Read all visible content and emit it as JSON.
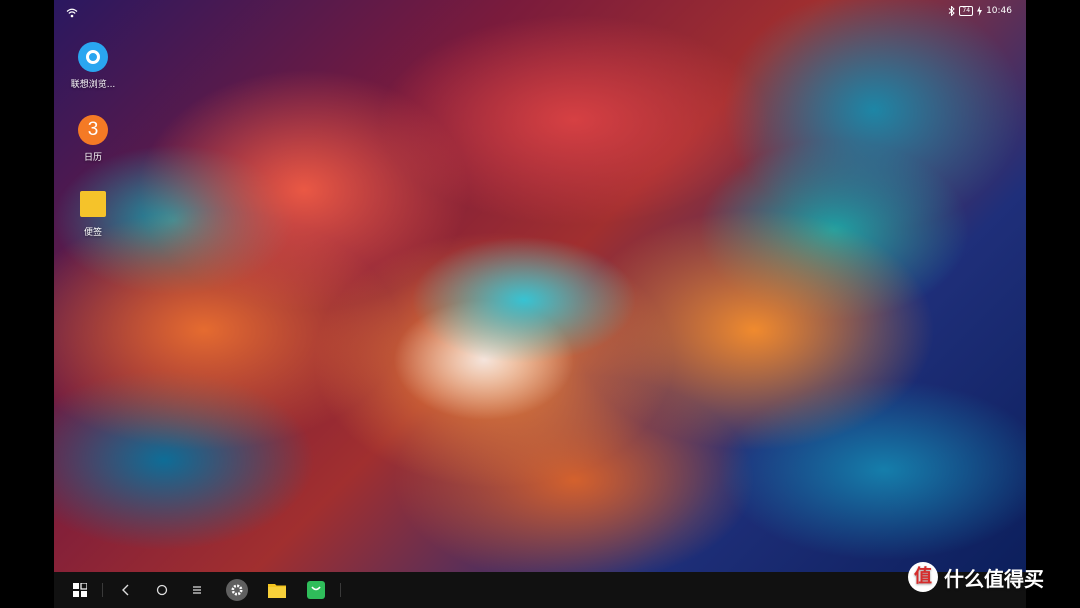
{
  "status_bar": {
    "wifi_icon": "wifi-icon",
    "bluetooth_icon": "bluetooth-icon",
    "battery_level": "74",
    "charging_icon": "lightning-icon",
    "time": "10:46"
  },
  "desktop_icons": [
    {
      "label": "联想浏览...",
      "icon": "browser-icon",
      "color": "#2aa6f0"
    },
    {
      "label": "日历",
      "icon": "calendar-icon",
      "glyph": "3",
      "color": "#f47a25"
    },
    {
      "label": "便签",
      "icon": "notes-icon",
      "color": "#f5c32a"
    }
  ],
  "taskbar": {
    "items": [
      "windows-start-icon",
      "back-icon",
      "home-icon",
      "menu-icon",
      "settings-icon",
      "file-folder-icon",
      "app-store-icon"
    ]
  },
  "watermark": {
    "logo_glyph": "值",
    "text": "什么值得买"
  }
}
